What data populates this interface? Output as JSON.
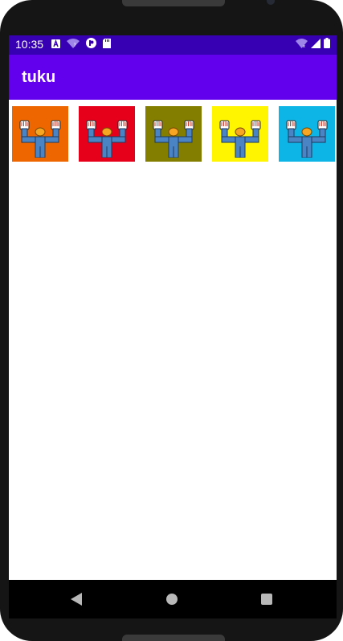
{
  "status_bar": {
    "time": "10:35",
    "left_icons": [
      "a-icon",
      "wifi-question-icon",
      "p-icon",
      "sd-card-icon"
    ],
    "right_icons": [
      "wifi-icon",
      "signal-icon",
      "battery-icon"
    ],
    "background": "#3700b3"
  },
  "app_bar": {
    "title": "tuku",
    "background": "#6200ee"
  },
  "tiles": [
    {
      "color": "#ee6600",
      "icon": "person-raising-hands-icon"
    },
    {
      "color": "#e6001a",
      "icon": "person-raising-hands-icon"
    },
    {
      "color": "#847e00",
      "icon": "person-raising-hands-icon"
    },
    {
      "color": "#fff500",
      "icon": "person-raising-hands-icon"
    },
    {
      "color": "#0db4e6",
      "icon": "person-raising-hands-icon"
    }
  ],
  "nav_bar": {
    "buttons": [
      "back",
      "home",
      "recents"
    ]
  }
}
